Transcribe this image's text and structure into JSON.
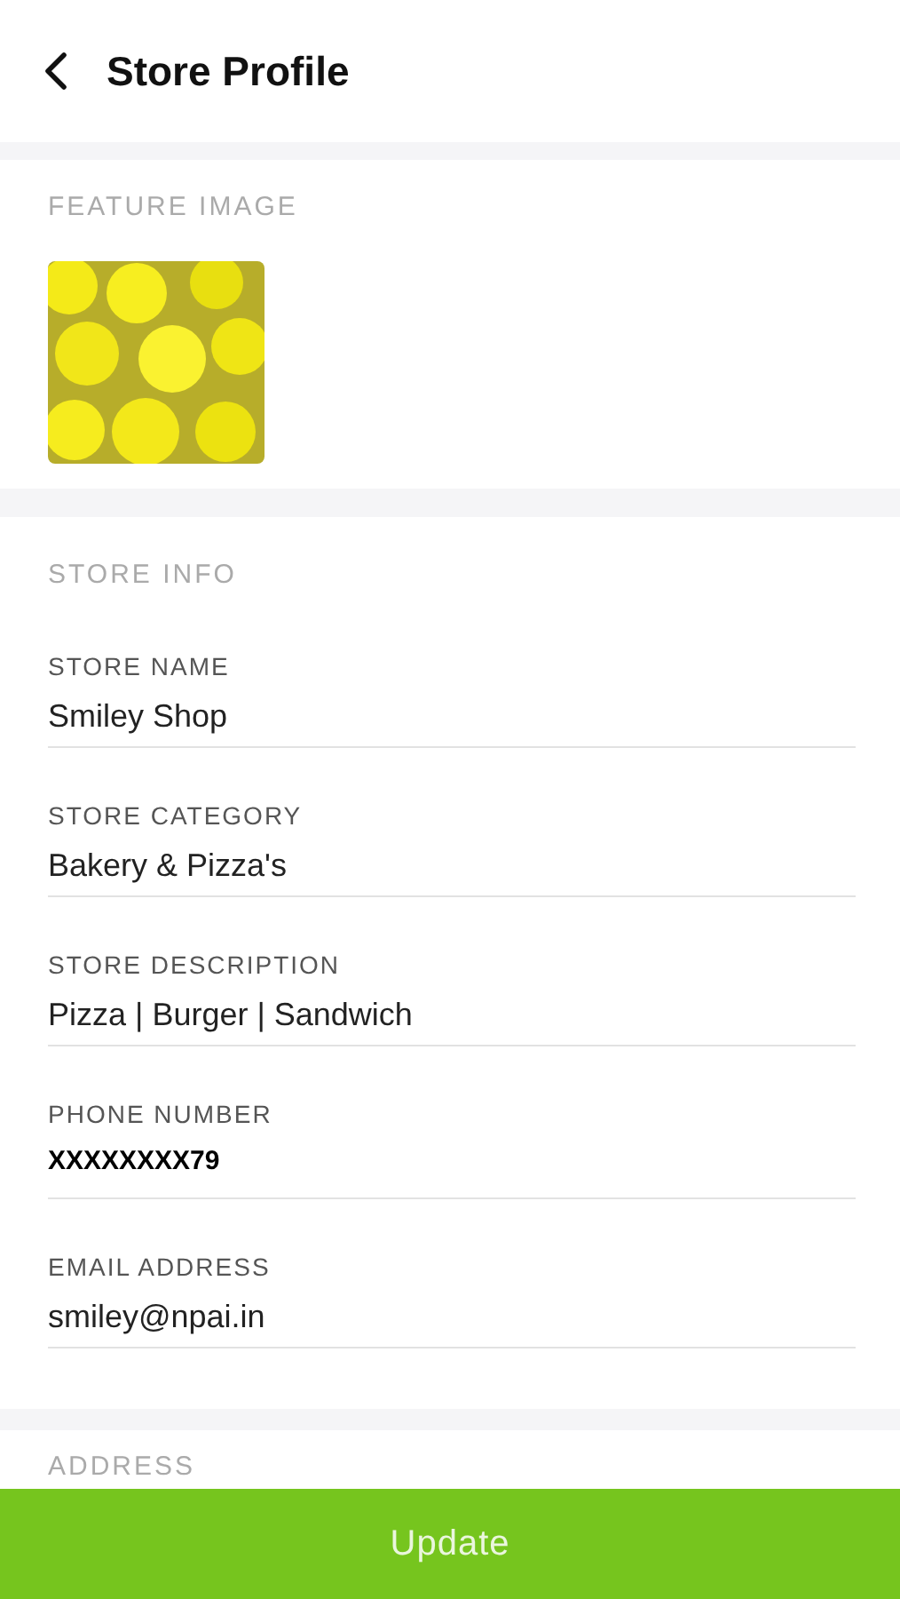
{
  "header": {
    "title": "Store Profile"
  },
  "feature_image": {
    "label": "FEATURE IMAGE"
  },
  "store_info": {
    "label": "STORE INFO",
    "fields": [
      {
        "label": "STORE NAME",
        "value": "Smiley Shop",
        "kind": "text"
      },
      {
        "label": "STORE CATEGORY",
        "value": "Bakery & Pizza's",
        "kind": "text"
      },
      {
        "label": "STORE DESCRIPTION",
        "value": "Pizza | Burger | Sandwich",
        "kind": "text"
      },
      {
        "label": "PHONE NUMBER",
        "value": "XXXXXXXX79",
        "kind": "masked"
      },
      {
        "label": "EMAIL ADDRESS",
        "value": "smiley@npai.in",
        "kind": "text"
      }
    ]
  },
  "address": {
    "label": "ADDRESS"
  },
  "update_button": {
    "label": "Update"
  }
}
